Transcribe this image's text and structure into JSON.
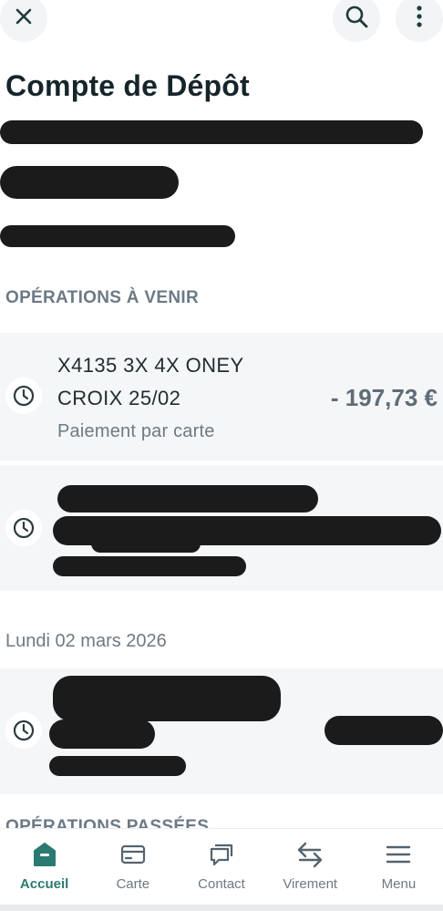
{
  "header": {
    "title": "Compte de Dépôt"
  },
  "sections": {
    "upcoming_title": "OPÉRATIONS À VENIR",
    "past_title": "OPÉRATIONS PASSÉES"
  },
  "operations": [
    {
      "line1": "X4135 3X 4X ONEY",
      "line2": "CROIX 25/02",
      "subtitle": "Paiement par carte",
      "amount": "- 197,73 €"
    }
  ],
  "date_group": "Lundi 02 mars 2026",
  "bottom_nav": [
    {
      "label": "Accueil",
      "icon": "home-icon",
      "active": true
    },
    {
      "label": "Carte",
      "icon": "card-icon",
      "active": false
    },
    {
      "label": "Contact",
      "icon": "chat-icon",
      "active": false
    },
    {
      "label": "Virement",
      "icon": "transfer-icon",
      "active": false
    },
    {
      "label": "Menu",
      "icon": "menu-icon",
      "active": false
    }
  ],
  "colors": {
    "accent": "#2b7a72",
    "text_dark": "#16252a",
    "muted": "#6d7a84",
    "card_bg": "#f5f6f7"
  }
}
